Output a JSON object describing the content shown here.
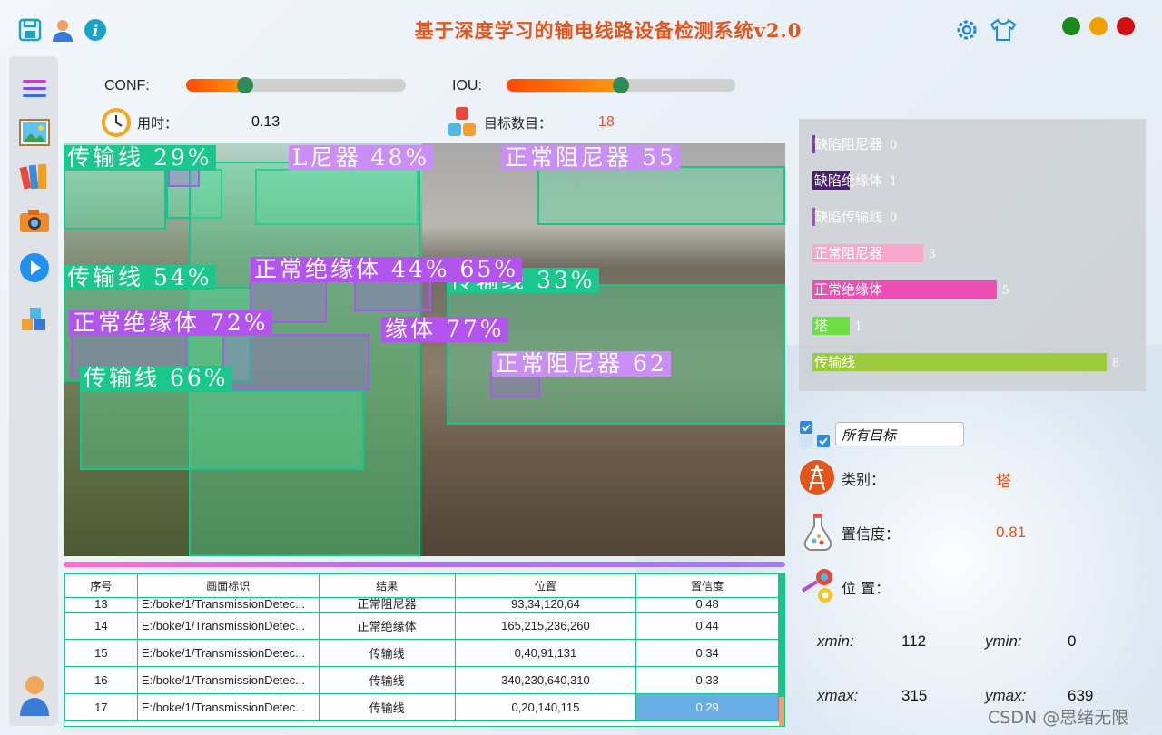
{
  "app": {
    "title": "基于深度学习的输电线路设备检测系统v2.0"
  },
  "colors": {
    "accent": "#e2561b",
    "green_box": "#18c48a",
    "purple_box": "#a35de8"
  },
  "toolbar": {
    "icons": [
      "save-icon",
      "user-icon",
      "info-icon"
    ],
    "right_icons": [
      "settings-icon",
      "skin-icon"
    ]
  },
  "window_controls": {
    "colors": [
      "#1a8a1a",
      "#f0a000",
      "#d01010"
    ]
  },
  "sidebar": {
    "items": [
      "menu-icon",
      "image-icon",
      "folder-icon",
      "camera-icon",
      "play-icon",
      "model-icon",
      "account-icon"
    ]
  },
  "controls": {
    "conf_label": "CONF:",
    "conf_value": 0.27,
    "iou_label": "IOU:",
    "iou_value": 0.5
  },
  "stats": {
    "time_label": "用时：",
    "time_value": "0.13",
    "count_label": "目标数目：",
    "count_value": "18"
  },
  "detections": [
    {
      "text": "传输线  29%",
      "color": "green"
    },
    {
      "text": "L尼器  48%",
      "color": "light"
    },
    {
      "text": "正常阻尼器  55",
      "color": "light"
    },
    {
      "text": "传输线  33%",
      "color": "green"
    },
    {
      "text": "传输线  54%",
      "color": "green"
    },
    {
      "text": "正常绝缘体  44%  65%",
      "color": "purple"
    },
    {
      "text": "正常绝缘体  72%",
      "color": "purple"
    },
    {
      "text": "缘体  77%",
      "color": "purple"
    },
    {
      "text": "传输线  66%",
      "color": "green"
    },
    {
      "text": "正常阻尼器  62",
      "color": "light"
    }
  ],
  "table": {
    "headers": [
      "序号",
      "画面标识",
      "结果",
      "位置",
      "置信度"
    ],
    "rows": [
      [
        "13",
        "E:/boke/1/TransmissionDetec...",
        "正常阻尼器",
        "93,34,120,64",
        "0.48"
      ],
      [
        "14",
        "E:/boke/1/TransmissionDetec...",
        "正常绝缘体",
        "165,215,236,260",
        "0.44"
      ],
      [
        "15",
        "E:/boke/1/TransmissionDetec...",
        "传输线",
        "0,40,91,131",
        "0.34"
      ],
      [
        "16",
        "E:/boke/1/TransmissionDetec...",
        "传输线",
        "340,230,640,310",
        "0.33"
      ],
      [
        "17",
        "E:/boke/1/TransmissionDetec...",
        "传输线",
        "0,20,140,115",
        "0.29"
      ]
    ]
  },
  "chart_data": {
    "type": "bar",
    "categories": [
      "缺陷阻尼器",
      "缺陷绝缘体",
      "缺陷传输线",
      "正常阻尼器",
      "正常绝缘体",
      "塔",
      "传输线"
    ],
    "values": [
      0,
      1,
      0,
      3,
      5,
      1,
      8
    ],
    "colors": [
      "#8a2be2",
      "#4b1f6e",
      "#b040e0",
      "#f7a8cc",
      "#ee4fb5",
      "#6de045",
      "#9ccc3c"
    ],
    "xlim": [
      0,
      8
    ]
  },
  "filter": {
    "value": "所有目标"
  },
  "info": {
    "class_label": "类别：",
    "class_value": "塔",
    "conf_label": "置信度：",
    "conf_value": "0.81",
    "pos_label": "位 置：",
    "xmin_label": "xmin:",
    "xmin_value": "112",
    "ymin_label": "ymin:",
    "ymin_value": "0",
    "xmax_label": "xmax:",
    "xmax_value": "315",
    "ymax_label": "ymax:",
    "ymax_value": "639"
  },
  "watermark": "CSDN @思绪无限"
}
